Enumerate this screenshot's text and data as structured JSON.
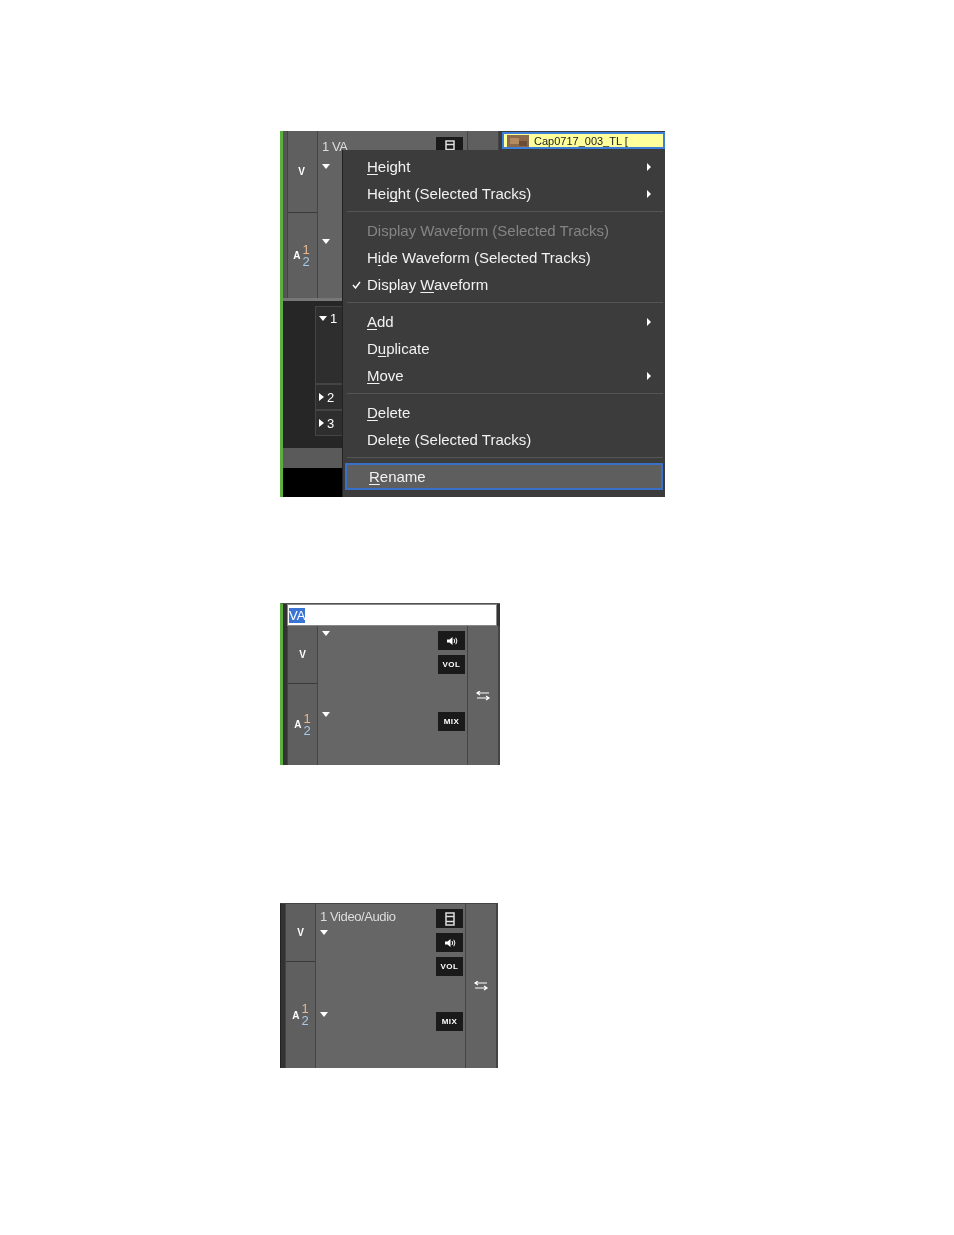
{
  "screens": [
    {
      "kind": "menu",
      "track_name": "1 VA",
      "clip": "Cap0717_003_TL [",
      "video_label": "V",
      "audio_label": "A",
      "channels": [
        "1",
        "2"
      ],
      "subtracks": [
        {
          "label": "1",
          "expanded": true
        },
        {
          "label": "2",
          "expanded": false
        },
        {
          "label": "3",
          "expanded": false
        }
      ],
      "menu": [
        [
          {
            "parts": [
              {
                "text": "H",
                "underlined": true
              },
              {
                "text": "eight",
                "underlined": false
              }
            ],
            "submenu": true,
            "disabled": false,
            "checked": false,
            "selected": false
          },
          {
            "parts": [
              {
                "text": "Hei",
                "underlined": false
              },
              {
                "text": "g",
                "underlined": true
              },
              {
                "text": "ht (Selected Tracks)",
                "underlined": false
              }
            ],
            "submenu": true,
            "disabled": false,
            "checked": false,
            "selected": false
          }
        ],
        [
          {
            "parts": [
              {
                "text": "Display Wave",
                "underlined": false
              },
              {
                "text": "f",
                "underlined": true
              },
              {
                "text": "orm (Selected Tracks)",
                "underlined": false
              }
            ],
            "submenu": false,
            "disabled": true,
            "checked": false,
            "selected": false
          },
          {
            "parts": [
              {
                "text": "H",
                "underlined": false
              },
              {
                "text": "i",
                "underlined": true
              },
              {
                "text": "de Waveform (Selected Tracks)",
                "underlined": false
              }
            ],
            "submenu": false,
            "disabled": false,
            "checked": false,
            "selected": false
          },
          {
            "parts": [
              {
                "text": "Display ",
                "underlined": false
              },
              {
                "text": "W",
                "underlined": true
              },
              {
                "text": "aveform",
                "underlined": false
              }
            ],
            "submenu": false,
            "disabled": false,
            "checked": true,
            "selected": false
          }
        ],
        [
          {
            "parts": [
              {
                "text": "A",
                "underlined": true
              },
              {
                "text": "dd",
                "underlined": false
              }
            ],
            "submenu": true,
            "disabled": false,
            "checked": false,
            "selected": false
          },
          {
            "parts": [
              {
                "text": "D",
                "underlined": false
              },
              {
                "text": "u",
                "underlined": true
              },
              {
                "text": "plicate",
                "underlined": false
              }
            ],
            "submenu": false,
            "disabled": false,
            "checked": false,
            "selected": false
          },
          {
            "parts": [
              {
                "text": "M",
                "underlined": true
              },
              {
                "text": "ove",
                "underlined": false
              }
            ],
            "submenu": true,
            "disabled": false,
            "checked": false,
            "selected": false
          }
        ],
        [
          {
            "parts": [
              {
                "text": "D",
                "underlined": true
              },
              {
                "text": "elete",
                "underlined": false
              }
            ],
            "submenu": false,
            "disabled": false,
            "checked": false,
            "selected": false
          },
          {
            "parts": [
              {
                "text": "Dele",
                "underlined": false
              },
              {
                "text": "t",
                "underlined": true
              },
              {
                "text": "e (Selected Tracks)",
                "underlined": false
              }
            ],
            "submenu": false,
            "disabled": false,
            "checked": false,
            "selected": false
          }
        ],
        [
          {
            "parts": [
              {
                "text": "R",
                "underlined": true
              },
              {
                "text": "ename",
                "underlined": false
              }
            ],
            "submenu": false,
            "disabled": false,
            "checked": false,
            "selected": true
          }
        ]
      ]
    },
    {
      "kind": "rename",
      "name_value": "VA",
      "video_label": "V",
      "audio_label": "A",
      "channels": [
        "1",
        "2"
      ],
      "vol": "VOL",
      "mix": "MIX"
    },
    {
      "kind": "renamed",
      "track_name": "1 Video/Audio",
      "video_label": "V",
      "audio_label": "A",
      "channels": [
        "1",
        "2"
      ],
      "vol": "VOL",
      "mix": "MIX"
    }
  ]
}
